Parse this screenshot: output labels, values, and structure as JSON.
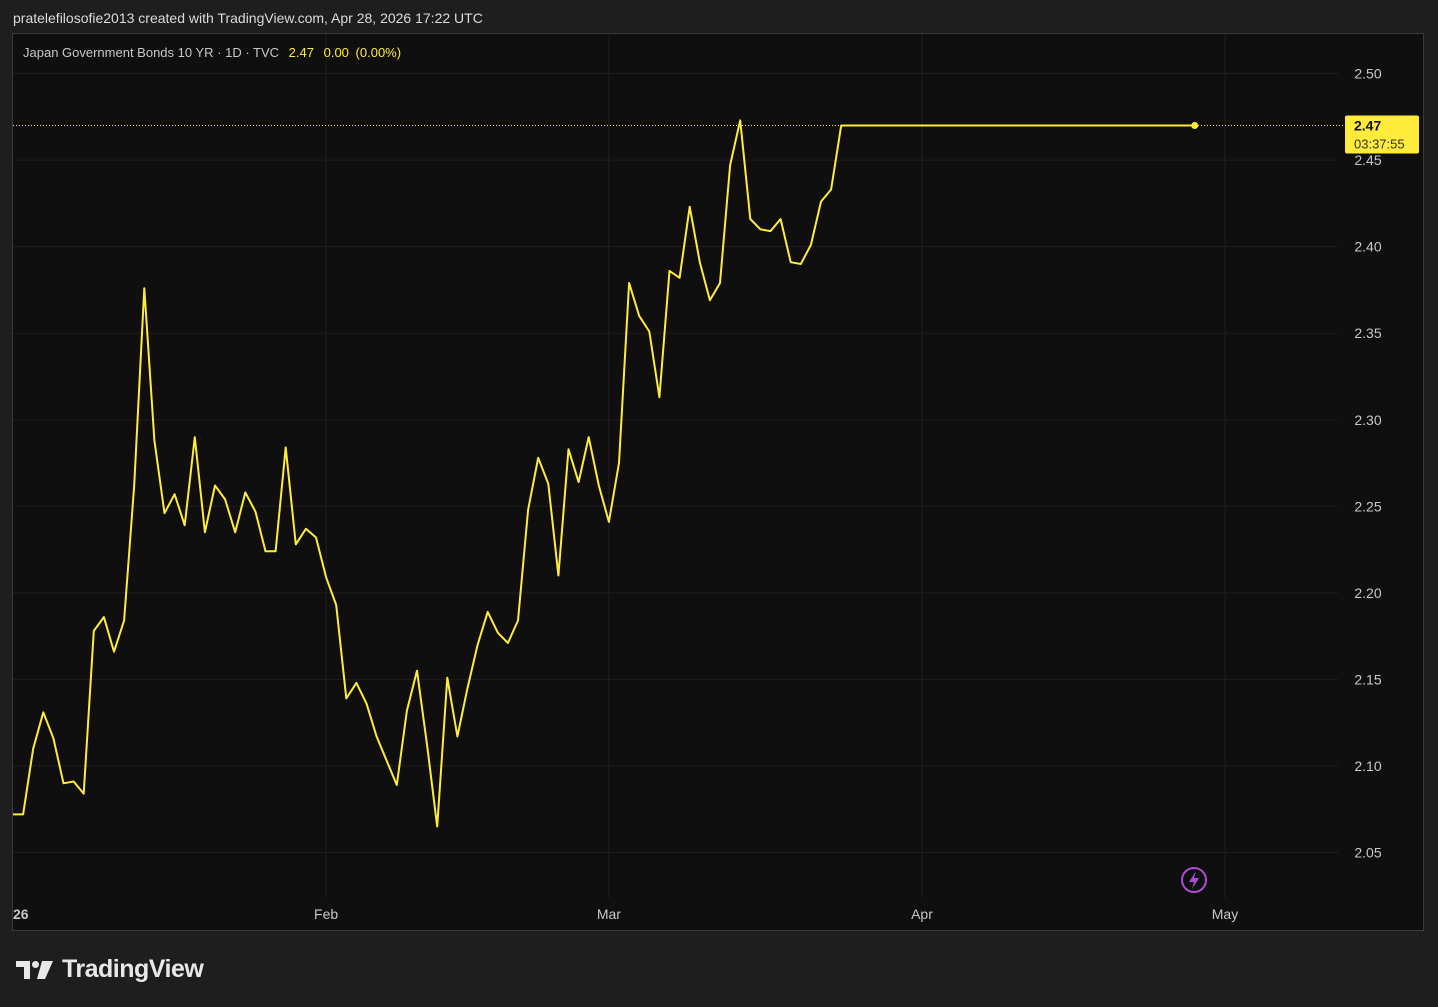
{
  "header": {
    "attribution": "pratelefilosofie2013 created with TradingView.com, Apr 28, 2026 17:22 UTC"
  },
  "legend": {
    "symbol": "Japan Government Bonds 10 YR · 1D · TVC",
    "last": "2.47",
    "change": "0.00",
    "change_pct": "(0.00%)"
  },
  "price_tag": {
    "price": "2.47",
    "countdown": "03:37:55"
  },
  "brand": {
    "name": "TradingView"
  },
  "colors": {
    "line": "#ffeb3b",
    "grid": "#1f1f1f",
    "axis_text": "#c8c8c8",
    "background": "#0f0f0f",
    "bolt": "#b04bd6"
  },
  "icons": {
    "bolt": "lightning-bolt-icon",
    "logo": "tradingview-logo-icon"
  },
  "chart_data": {
    "type": "line",
    "title": "Japan Government Bonds 10 YR",
    "xlabel": "",
    "ylabel": "",
    "ylim": [
      2.03,
      2.52
    ],
    "yticks": [
      2.05,
      2.1,
      2.15,
      2.2,
      2.25,
      2.3,
      2.35,
      2.4,
      2.45,
      2.5
    ],
    "ytick_labels": [
      "2.05",
      "2.10",
      "2.15",
      "2.20",
      "2.25",
      "2.30",
      "2.35",
      "2.40",
      "2.45",
      "2.50"
    ],
    "xticks": [
      {
        "label": "26",
        "date": "2026-01-01"
      },
      {
        "label": "Feb",
        "date": "2026-02-01"
      },
      {
        "label": "Mar",
        "date": "2026-03-01"
      },
      {
        "label": "Apr",
        "date": "2026-04-01"
      },
      {
        "label": "May",
        "date": "2026-05-01"
      }
    ],
    "xlim": [
      "2026-01-01",
      "2026-05-10"
    ],
    "grid": true,
    "last_value": 2.47,
    "series": [
      {
        "x": [
          "2026-01-01",
          "2026-01-02",
          "2026-01-03",
          "2026-01-04",
          "2026-01-05",
          "2026-01-06",
          "2026-01-07",
          "2026-01-08",
          "2026-01-09",
          "2026-01-10",
          "2026-01-11",
          "2026-01-12",
          "2026-01-13",
          "2026-01-14",
          "2026-01-15",
          "2026-01-16",
          "2026-01-17",
          "2026-01-18",
          "2026-01-19",
          "2026-01-20",
          "2026-01-21",
          "2026-01-22",
          "2026-01-23",
          "2026-01-24",
          "2026-01-25",
          "2026-01-26",
          "2026-01-27",
          "2026-01-28",
          "2026-01-29",
          "2026-01-30",
          "2026-01-31",
          "2026-02-01",
          "2026-02-02",
          "2026-02-03",
          "2026-02-04",
          "2026-02-05",
          "2026-02-06",
          "2026-02-07",
          "2026-02-08",
          "2026-02-09",
          "2026-02-10",
          "2026-02-11",
          "2026-02-12",
          "2026-02-13",
          "2026-02-14",
          "2026-02-15",
          "2026-02-16",
          "2026-02-17",
          "2026-02-18",
          "2026-02-19",
          "2026-02-20",
          "2026-02-21",
          "2026-02-22",
          "2026-02-23",
          "2026-02-24",
          "2026-02-25",
          "2026-02-26",
          "2026-02-27",
          "2026-02-28",
          "2026-03-01",
          "2026-03-02",
          "2026-03-03",
          "2026-03-04",
          "2026-03-05",
          "2026-03-06",
          "2026-03-07",
          "2026-03-08",
          "2026-03-09",
          "2026-03-10",
          "2026-03-11",
          "2026-03-12",
          "2026-03-13",
          "2026-03-14",
          "2026-03-15",
          "2026-03-16",
          "2026-03-17",
          "2026-03-18",
          "2026-03-19",
          "2026-03-20",
          "2026-03-21",
          "2026-03-22",
          "2026-03-23",
          "2026-03-24",
          "2026-03-25",
          "2026-03-26",
          "2026-03-27",
          "2026-03-28",
          "2026-03-29",
          "2026-03-30",
          "2026-03-31",
          "2026-04-01",
          "2026-04-02",
          "2026-04-03",
          "2026-04-04",
          "2026-04-05",
          "2026-04-06",
          "2026-04-07",
          "2026-04-08",
          "2026-04-09",
          "2026-04-10",
          "2026-04-11",
          "2026-04-12",
          "2026-04-13",
          "2026-04-14",
          "2026-04-15",
          "2026-04-16",
          "2026-04-17",
          "2026-04-18",
          "2026-04-19",
          "2026-04-20",
          "2026-04-21",
          "2026-04-22",
          "2026-04-23",
          "2026-04-24",
          "2026-04-25",
          "2026-04-26",
          "2026-04-27",
          "2026-04-28"
        ],
        "values": [
          2.072,
          2.072,
          2.11,
          2.131,
          2.116,
          2.09,
          2.091,
          2.084,
          2.178,
          2.186,
          2.166,
          2.184,
          2.262,
          2.376,
          2.288,
          2.246,
          2.257,
          2.239,
          2.29,
          2.235,
          2.262,
          2.254,
          2.235,
          2.258,
          2.247,
          2.224,
          2.224,
          2.284,
          2.228,
          2.237,
          2.232,
          2.209,
          2.193,
          2.139,
          2.148,
          2.136,
          2.117,
          2.103,
          2.089,
          2.132,
          2.155,
          2.112,
          2.065,
          2.151,
          2.117,
          2.145,
          2.17,
          2.189,
          2.177,
          2.171,
          2.184,
          2.248,
          2.278,
          2.263,
          2.21,
          2.283,
          2.264,
          2.29,
          2.262,
          2.241,
          2.275,
          2.379,
          2.36,
          2.351,
          2.313,
          2.386,
          2.382,
          2.423,
          2.391,
          2.369,
          2.379,
          2.447,
          2.473,
          2.416,
          2.41,
          2.409,
          2.416,
          2.391,
          2.39,
          2.401,
          2.426,
          2.433,
          2.47,
          2.47,
          2.47,
          2.47,
          2.47,
          2.47,
          2.47,
          2.47,
          2.47,
          2.47,
          2.47,
          2.47,
          2.47,
          2.47,
          2.47,
          2.47,
          2.47,
          2.47,
          2.47,
          2.47,
          2.47,
          2.47,
          2.47,
          2.47,
          2.47,
          2.47,
          2.47,
          2.47,
          2.47,
          2.47,
          2.47,
          2.47,
          2.47,
          2.47,
          2.47,
          2.47
        ]
      }
    ]
  }
}
